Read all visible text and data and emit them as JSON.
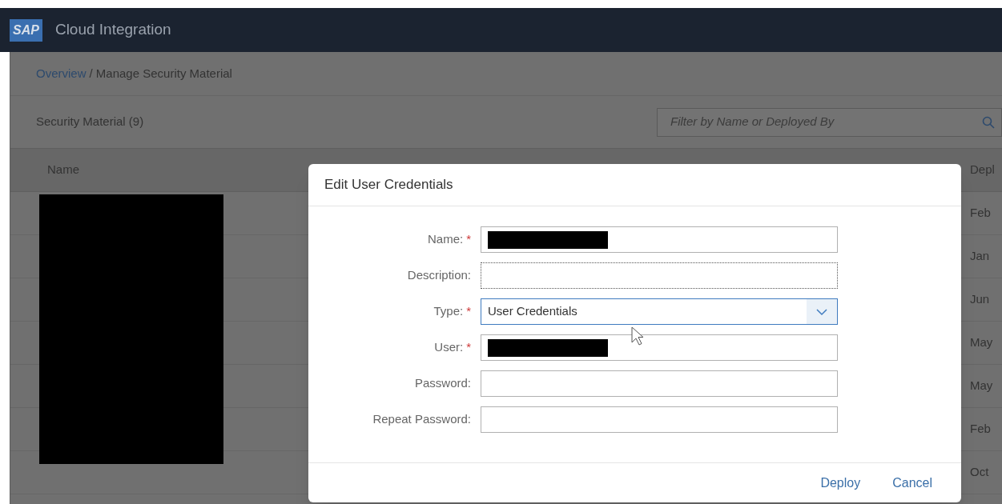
{
  "header": {
    "logo": "SAP",
    "title": "Cloud Integration"
  },
  "breadcrumb": {
    "link": "Overview",
    "current": "/ Manage Security Material"
  },
  "toolbar": {
    "title": "Security Material (9)",
    "search": {
      "placeholder": "Filter by Name or Deployed By"
    }
  },
  "table": {
    "columns": [
      "Name",
      "Depl"
    ],
    "rows": [
      {
        "column_2": "Feb"
      },
      {
        "column_2": "Jan"
      },
      {
        "column_2": "Jun"
      },
      {
        "column_2": "May"
      },
      {
        "column_2": "May"
      },
      {
        "column_2": "Feb"
      },
      {
        "column_2": "Oct"
      }
    ]
  },
  "dialog": {
    "title": "Edit User Credentials",
    "fields": [
      {
        "label": "Name:",
        "kind": "text",
        "required_mark": "*",
        "redacted": true,
        "focused": false
      },
      {
        "label": "Description:",
        "kind": "text",
        "redacted": false,
        "focused": true
      },
      {
        "label": "Type:",
        "kind": "select",
        "required_mark": "*",
        "focused": false,
        "value": "User Credentials"
      },
      {
        "label": "User:",
        "kind": "text",
        "required_mark": "*",
        "redacted": true,
        "focused": false
      },
      {
        "label": "Password:",
        "kind": "text",
        "redacted": false,
        "focused": false
      },
      {
        "label": "Repeat Password:",
        "kind": "text",
        "redacted": false,
        "focused": false
      }
    ],
    "buttons": [
      "Deploy",
      "Cancel"
    ]
  }
}
